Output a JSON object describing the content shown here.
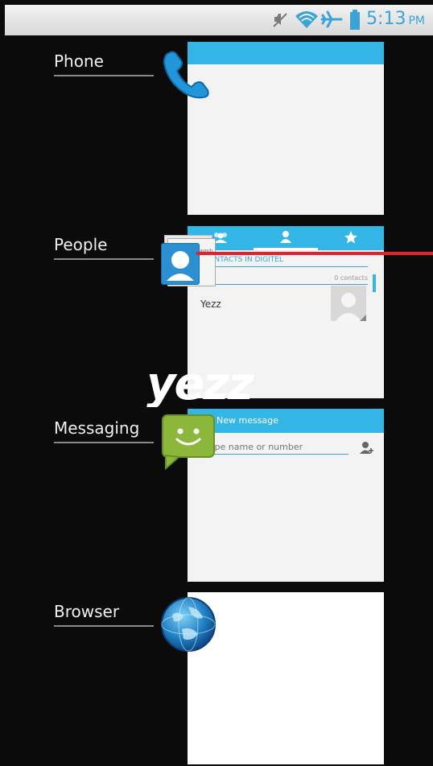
{
  "status_bar": {
    "time": "5:13",
    "ampm": "PM",
    "icons": [
      "mute-icon",
      "wifi-icon",
      "airplane-icon",
      "battery-icon"
    ],
    "accent_color": "#3aa3d8"
  },
  "recent_apps": [
    {
      "label": "Phone",
      "icon": "phone-icon"
    },
    {
      "label": "People",
      "icon": "people-icon",
      "preview": {
        "section": "CONTACTS IN DIGITEL",
        "count": "0 contacts",
        "contact": "Yezz",
        "mini_label": "Launch"
      }
    },
    {
      "label": "Messaging",
      "icon": "messaging-icon",
      "preview": {
        "title": "New message",
        "placeholder": "Type name or number"
      }
    },
    {
      "label": "Browser",
      "icon": "globe-icon"
    }
  ],
  "watermark": {
    "text": "yezz"
  },
  "colors": {
    "accent_blue": "#33b5e5",
    "background": "#0b0b0b",
    "indicator_red": "#e8202a"
  }
}
